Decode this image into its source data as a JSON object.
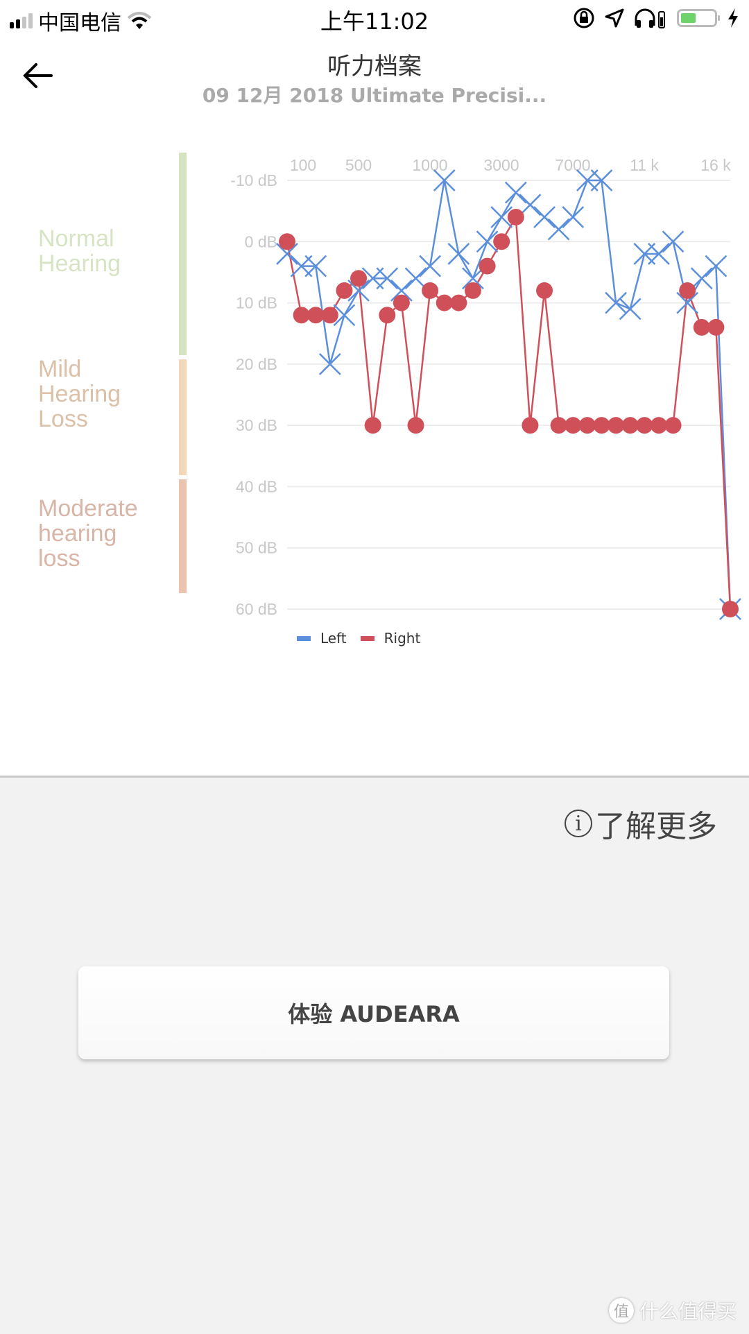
{
  "status_bar": {
    "carrier": "中国电信",
    "time": "上午11:02",
    "battery_level": 0.45,
    "icons": [
      "signal-icon",
      "wifi-icon",
      "rotation-lock-icon",
      "location-icon",
      "headphones-icon",
      "battery-icon",
      "charging-icon"
    ]
  },
  "header": {
    "title": "听力档案",
    "subtitle": "09 12月 2018 Ultimate Precisi..."
  },
  "zones": [
    {
      "label": "Normal Hearing",
      "color": "#d6e3c1",
      "text_color": "#d7e4c4"
    },
    {
      "label": "Mild Hearing Loss",
      "color": "#f2d8b8",
      "text_color": "#dcc0a7"
    },
    {
      "label": "Moderate hearing loss",
      "color": "#ebc4b0",
      "text_color": "#d8b5a6"
    }
  ],
  "chart_data": {
    "type": "line",
    "title": "",
    "xlabel": "",
    "ylabel": "",
    "x_tick_labels": [
      "100",
      "500",
      "1000",
      "3000",
      "7000",
      "11 k",
      "16 k"
    ],
    "y_tick_labels": [
      "-10 dB",
      "0 dB",
      "10 dB",
      "20 dB",
      "30 dB",
      "40 dB",
      "50 dB",
      "60 dB"
    ],
    "y_ticks": [
      -10,
      0,
      10,
      20,
      30,
      40,
      50,
      60
    ],
    "ylim": [
      -10,
      60
    ],
    "y_inverted": true,
    "grid": true,
    "legend_position": "bottom-left",
    "point_count": 32,
    "series": [
      {
        "name": "Left",
        "color": "#5b8fdb",
        "marker": "x",
        "values": [
          2,
          4,
          4,
          20,
          12,
          8,
          6,
          6,
          8,
          6,
          4,
          -10,
          2,
          6,
          0,
          -4,
          -8,
          -6,
          -4,
          -2,
          -4,
          -10,
          -10,
          10,
          11,
          2,
          2,
          0,
          10,
          6,
          4,
          60
        ]
      },
      {
        "name": "Right",
        "color": "#d0505a",
        "marker": "circle",
        "values": [
          0,
          12,
          12,
          12,
          8,
          6,
          30,
          12,
          10,
          30,
          8,
          10,
          10,
          8,
          4,
          0,
          -4,
          30,
          8,
          30,
          30,
          30,
          30,
          30,
          30,
          30,
          30,
          30,
          8,
          14,
          14,
          60
        ]
      }
    ]
  },
  "legend": {
    "left": "Left",
    "right": "Right"
  },
  "learn_more": {
    "label": "了解更多",
    "icon": "info-icon"
  },
  "cta": {
    "label": "体验 AUDEARA"
  },
  "watermark": {
    "icon_text": "值",
    "text": "什么值得买"
  }
}
